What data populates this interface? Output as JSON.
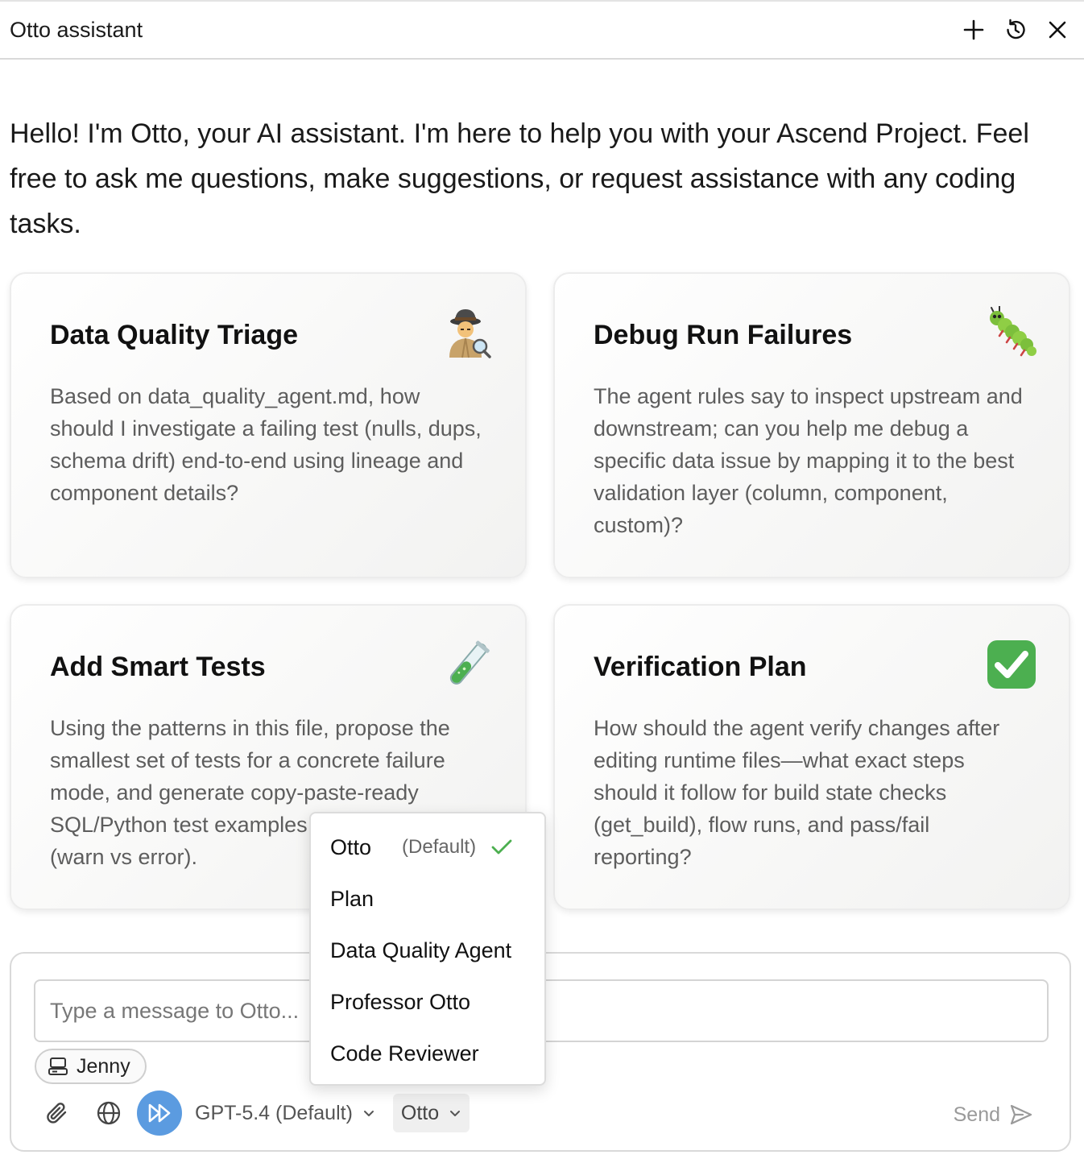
{
  "header": {
    "title": "Otto assistant",
    "icons": [
      "plus-icon",
      "history-icon",
      "close-icon"
    ]
  },
  "intro": {
    "text": "Hello! I'm Otto, your AI assistant. I'm here to help you with your Ascend Project. Feel free to ask me questions, make suggestions, or request assistance with any coding tasks."
  },
  "cards": [
    {
      "title": "Data Quality Triage",
      "icon": "detective-emoji",
      "body": "Based on data_quality_agent.md, how should I investigate a failing test (nulls, dups, schema drift) end-to-end using lineage and component details?"
    },
    {
      "title": "Debug Run Failures",
      "icon": "bug-emoji",
      "body": "The agent rules say to inspect upstream and downstream; can you help me debug a specific data issue by mapping it to the best validation layer (column, component, custom)?"
    },
    {
      "title": "Add Smart Tests",
      "icon": "test-tube-emoji",
      "body": "Using the patterns in this file, propose the smallest set of tests for a concrete failure mode, and generate copy-paste-ready SQL/Python test examples with severity (warn vs error)."
    },
    {
      "title": "Verification Plan",
      "icon": "check-mark-emoji",
      "body": "How should the agent verify changes after editing runtime files—what exact steps should it follow for build state checks (get_build), flow runs, and pass/fail reporting?"
    }
  ],
  "composer": {
    "placeholder": "Type a message to Otto...",
    "context_chip": "Jenny",
    "model": "GPT-5.4 (Default)",
    "agent": "Otto",
    "send_label": "Send"
  },
  "agent_menu": {
    "items": [
      {
        "label": "Otto",
        "sub": "(Default)",
        "selected": true
      },
      {
        "label": "Plan"
      },
      {
        "label": "Data Quality Agent"
      },
      {
        "label": "Professor Otto"
      },
      {
        "label": "Code Reviewer"
      }
    ]
  },
  "colors": {
    "accent": "#5b9be0",
    "check": "#4caf50"
  }
}
